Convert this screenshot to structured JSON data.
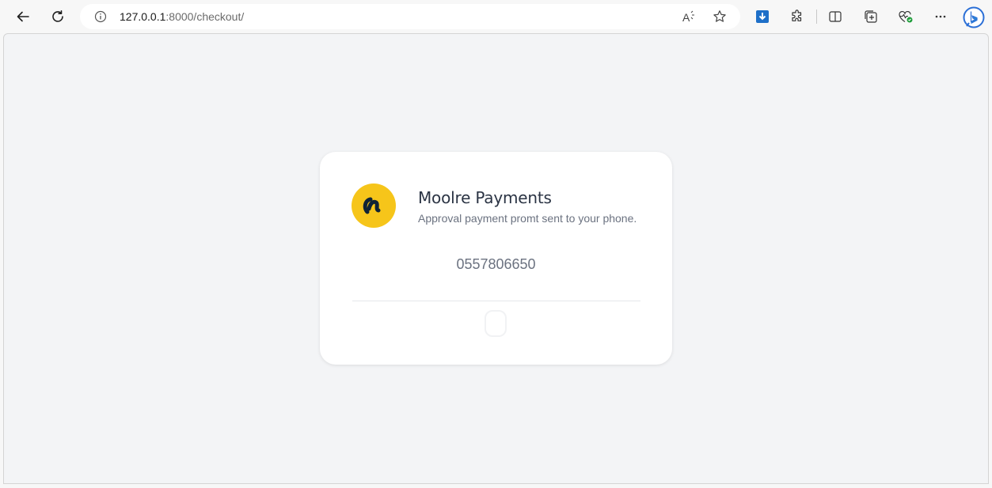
{
  "browser": {
    "url_host": "127.0.0.1",
    "url_path": ":8000/checkout/",
    "icons": {
      "back": "back-arrow-icon",
      "refresh": "refresh-icon",
      "info": "info-icon",
      "read_aloud": "read-aloud-icon",
      "favorite": "star-icon",
      "download": "download-extension-icon",
      "extensions": "puzzle-icon",
      "split_screen": "split-screen-icon",
      "collections": "collections-icon",
      "performance": "heart-pulse-icon",
      "more": "more-dots-icon",
      "copilot": "bing-copilot-icon"
    }
  },
  "card": {
    "title": "Moolre Payments",
    "subtitle": "Approval payment promt sent to your phone.",
    "phone": "0557806650",
    "logo_color": "#f6c51a",
    "logo_mark_color": "#0f2336"
  }
}
